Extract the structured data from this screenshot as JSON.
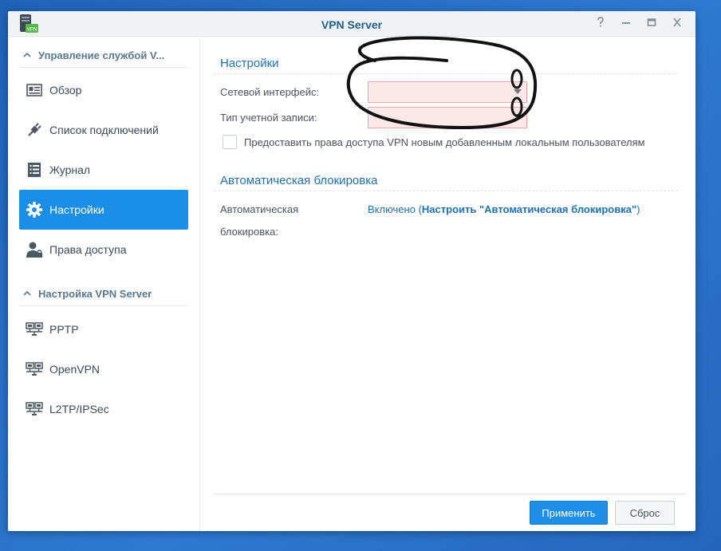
{
  "window": {
    "title": "VPN Server",
    "app_icon_badge": "VPN"
  },
  "sidebar": {
    "group1": "Управление службой V...",
    "items": [
      {
        "label": "Обзор",
        "icon": "overview-icon"
      },
      {
        "label": "Список подключений",
        "icon": "plug-icon"
      },
      {
        "label": "Журнал",
        "icon": "log-icon"
      },
      {
        "label": "Настройки",
        "icon": "gear-icon",
        "active": true
      },
      {
        "label": "Права доступа",
        "icon": "user-lock-icon"
      }
    ],
    "group2": "Настройка VPN Server",
    "protocols": [
      {
        "label": "PPTP",
        "icon": "network-icon"
      },
      {
        "label": "OpenVPN",
        "icon": "network-icon"
      },
      {
        "label": "L2TP/IPSec",
        "icon": "network-icon"
      }
    ]
  },
  "settings": {
    "title": "Настройки",
    "network_interface_label": "Сетевой интерфейс:",
    "network_interface_value": "",
    "account_type_label": "Тип учетной записи:",
    "account_type_value": "",
    "grant_access_label": "Предоставить права доступа VPN новым добавленным локальным пользователям"
  },
  "autoblock": {
    "title": "Автоматическая блокировка",
    "label_line1": "Автоматическая",
    "label_line2": "блокировка:",
    "status": "Включено (",
    "link": "Настроить \"Автоматическая блокировка\"",
    "close": ")"
  },
  "footer": {
    "apply": "Применить",
    "reset": "Сброс"
  },
  "colors": {
    "accent": "#1b8ee8",
    "link": "#1d70b8",
    "error_bg": "#fde8e8"
  }
}
